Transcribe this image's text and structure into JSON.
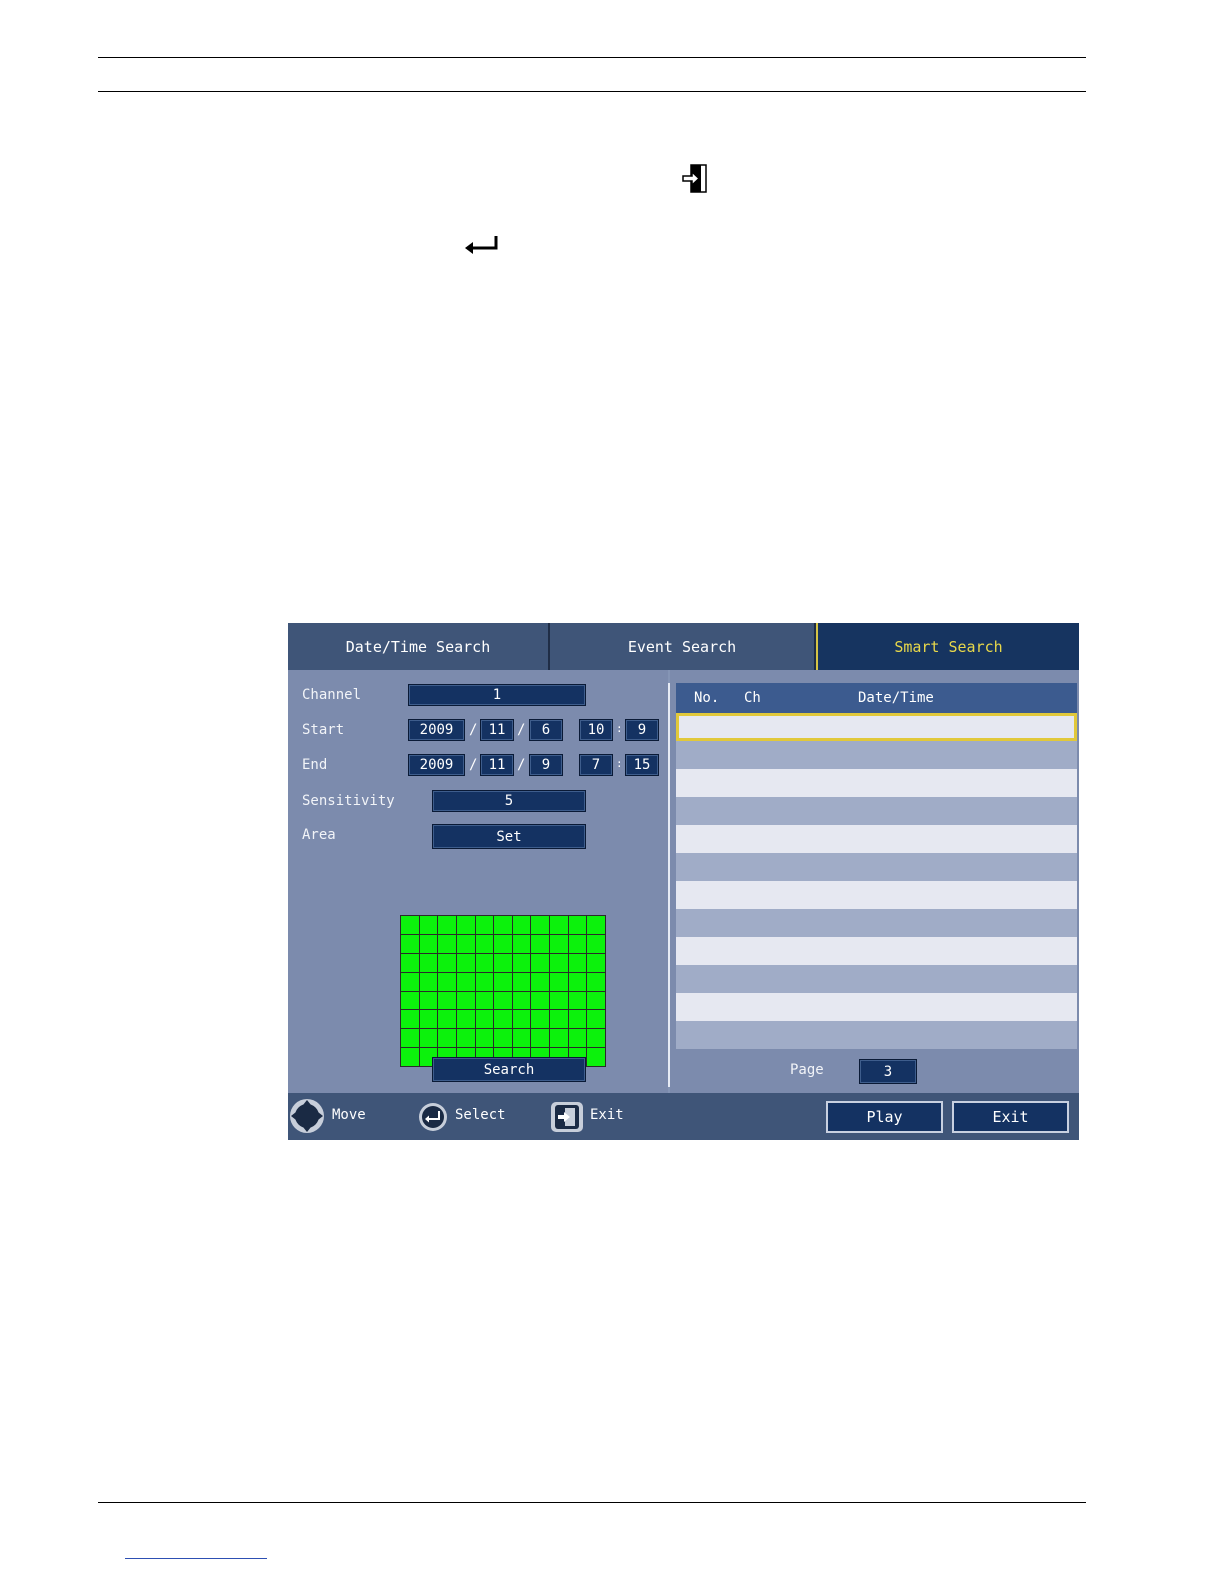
{
  "tabs": [
    {
      "label": "Date/Time Search",
      "active": false
    },
    {
      "label": "Event Search",
      "active": false
    },
    {
      "label": "Smart Search",
      "active": true
    }
  ],
  "form": {
    "channel_label": "Channel",
    "channel_value": "1",
    "start_label": "Start",
    "start": {
      "year": "2009",
      "month": "11",
      "day": "6",
      "hour": "10",
      "minute": "9"
    },
    "end_label": "End",
    "end": {
      "year": "2009",
      "month": "11",
      "day": "9",
      "hour": "7",
      "minute": "15"
    },
    "date_sep": "/",
    "time_sep": ":",
    "sensitivity_label": "Sensitivity",
    "sensitivity_value": "5",
    "area_label": "Area",
    "area_button": "Set",
    "search_button": "Search"
  },
  "results": {
    "columns": [
      "No.",
      "Ch",
      "Date/Time"
    ],
    "page_label": "Page",
    "page_value": "3"
  },
  "bottom_bar": {
    "move_label": "Move",
    "select_label": "Select",
    "exit_hint_label": "Exit",
    "play_button": "Play",
    "exit_button": "Exit"
  },
  "colors": {
    "active_tab_text": "#e8d84a",
    "grid_cell": "#0cf20c",
    "field_bg": "#143262",
    "selection_border": "#e1c83a"
  },
  "icons": [
    "exit-icon",
    "enter-icon",
    "move-icon",
    "select-icon"
  ]
}
